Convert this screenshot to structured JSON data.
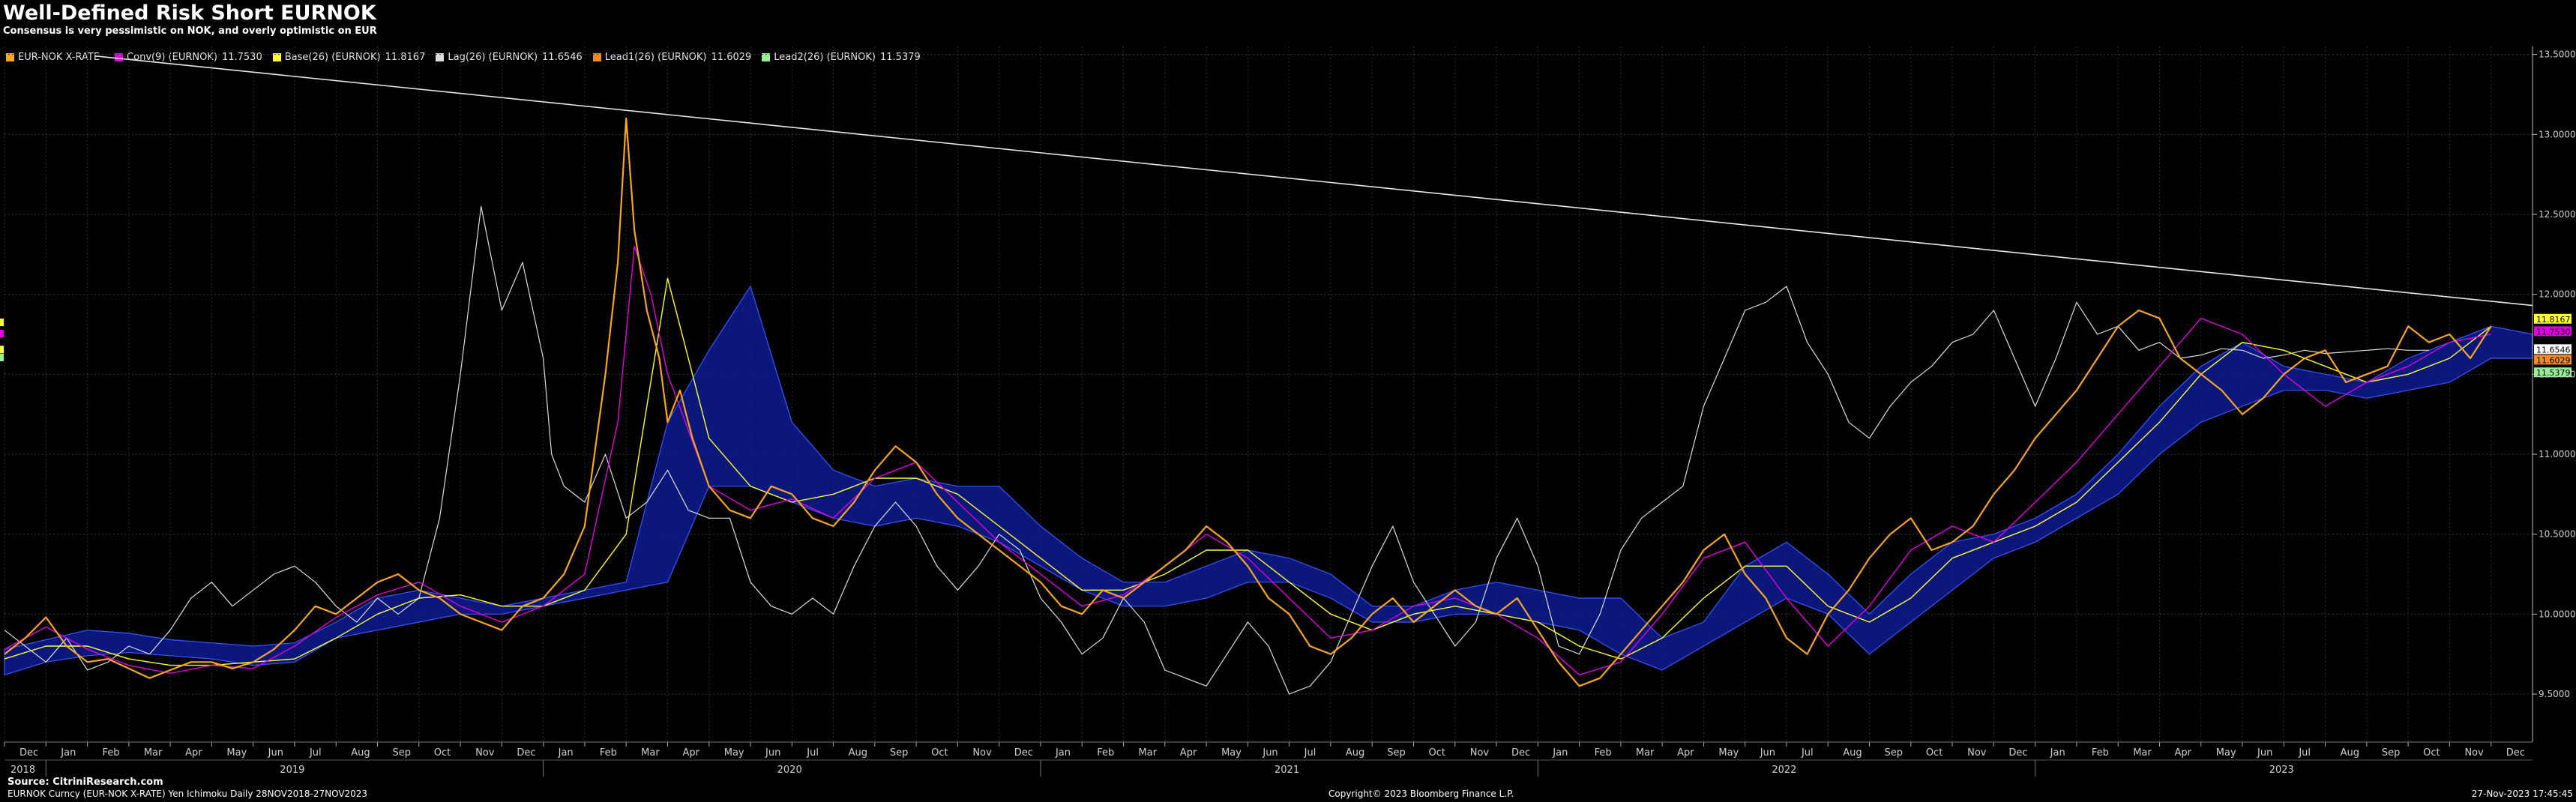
{
  "header": {
    "title": "Well-Defined Risk Short EURNOK",
    "subtitle": "Consensus is very pessimistic on NOK, and overly optimistic on EUR"
  },
  "legend": [
    {
      "label": "EUR-NOK X-RATE",
      "value": "",
      "color": "#f5a623"
    },
    {
      "label": "Conv(9) (EURNOK)",
      "value": "11.7530",
      "color": "#e000e0"
    },
    {
      "label": "Base(26) (EURNOK)",
      "value": "11.8167",
      "color": "#ffff33"
    },
    {
      "label": "Lag(26) (EURNOK)",
      "value": "11.6546",
      "color": "#dddddd"
    },
    {
      "label": "Lead1(26) (EURNOK)",
      "value": "11.6029",
      "color": "#f28c28"
    },
    {
      "label": "Lead2(26) (EURNOK)",
      "value": "11.5379",
      "color": "#99ee99"
    }
  ],
  "footer": {
    "source": "Source: CitriniResearch.com",
    "ticker": "EURNOK Curncy (EUR-NOK X-RATE) Yen Ichimoku  Daily 28NOV2018-27NOV2023",
    "copyright": "Copyright© 2023 Bloomberg Finance L.P.",
    "timestamp": "27-Nov-2023 17:45:45"
  },
  "chart_data": {
    "type": "line",
    "ylim": [
      9.2,
      13.55
    ],
    "yticks": [
      "9.5000",
      "10.0000",
      "10.5000",
      "11.0000",
      "11.5000",
      "12.0000",
      "12.5000",
      "13.0000",
      "13.5000"
    ],
    "ytick_values": [
      9.5,
      10.0,
      10.5,
      11.0,
      11.5,
      12.0,
      12.5,
      13.0,
      13.5
    ],
    "x_range_months": [
      0,
      61
    ],
    "month_ticks": [
      "Dec",
      "Jan",
      "Feb",
      "Mar",
      "Apr",
      "May",
      "Jun",
      "Jul",
      "Aug",
      "Sep",
      "Oct",
      "Nov",
      "Dec",
      "Jan",
      "Feb",
      "Mar",
      "Apr",
      "May",
      "Jun",
      "Jul",
      "Aug",
      "Sep",
      "Oct",
      "Nov",
      "Dec",
      "Jan",
      "Feb",
      "Mar",
      "Apr",
      "May",
      "Jun",
      "Jul",
      "Aug",
      "Sep",
      "Oct",
      "Nov",
      "Dec",
      "Jan",
      "Feb",
      "Mar",
      "Apr",
      "May",
      "Jun",
      "Jul",
      "Aug",
      "Sep",
      "Oct",
      "Nov",
      "Dec",
      "Jan",
      "Feb",
      "Mar",
      "Apr",
      "May",
      "Jun",
      "Jul",
      "Aug",
      "Sep",
      "Oct",
      "Nov",
      "Dec"
    ],
    "year_labels": [
      {
        "label": "2018",
        "month": 0
      },
      {
        "label": "2019",
        "month": 6.5
      },
      {
        "label": "2020",
        "month": 18.5
      },
      {
        "label": "2021",
        "month": 30.5
      },
      {
        "label": "2022",
        "month": 42.5
      },
      {
        "label": "2023",
        "month": 54.5
      }
    ],
    "trendline": {
      "x": [
        2.2,
        61.0
      ],
      "y": [
        13.49,
        11.93
      ]
    },
    "right_markers": [
      {
        "value": "11.8167",
        "y": 11.8167,
        "color": "#ffff33"
      },
      {
        "value": "11.7530",
        "y": 11.753,
        "color": "#e000e0"
      },
      {
        "value": "11.6546",
        "y": 11.6546,
        "color": "#ffffff"
      },
      {
        "value": "11.6029",
        "y": 11.6029,
        "color": "#f28c28"
      },
      {
        "value": "11.5379",
        "y": 11.5379,
        "color": "#99ee99"
      }
    ],
    "series": [
      {
        "name": "EUR-NOK X-RATE",
        "color": "#f5a623",
        "x": [
          0,
          0.5,
          1,
          1.5,
          2,
          2.5,
          3,
          3.5,
          4,
          4.5,
          5,
          5.5,
          6,
          6.5,
          7,
          7.5,
          8,
          8.5,
          9,
          9.5,
          10,
          10.5,
          11,
          11.5,
          12,
          12.5,
          13,
          13.5,
          14,
          14.5,
          14.8,
          15,
          15.2,
          15.5,
          15.8,
          16,
          16.3,
          16.6,
          17,
          17.5,
          18,
          18.5,
          19,
          19.5,
          20,
          20.5,
          21,
          21.5,
          22,
          22.5,
          23,
          23.5,
          24,
          24.5,
          25,
          25.5,
          26,
          26.5,
          27,
          27.5,
          28,
          28.5,
          29,
          29.5,
          30,
          30.5,
          31,
          31.5,
          32,
          32.5,
          33,
          33.5,
          34,
          34.5,
          35,
          35.5,
          36,
          36.5,
          37,
          37.5,
          38,
          38.5,
          39,
          39.5,
          40,
          40.5,
          41,
          41.5,
          42,
          42.5,
          43,
          43.5,
          44,
          44.5,
          45,
          45.5,
          46,
          46.5,
          47,
          47.5,
          48,
          48.5,
          49,
          49.5,
          50,
          50.5,
          51,
          51.5,
          52,
          52.5,
          53,
          53.5,
          54,
          54.5,
          55,
          55.5,
          56,
          56.5,
          57,
          57.5,
          58,
          58.5,
          59,
          59.5,
          60
        ],
        "y": [
          9.75,
          9.85,
          9.98,
          9.8,
          9.7,
          9.72,
          9.66,
          9.6,
          9.65,
          9.7,
          9.7,
          9.66,
          9.7,
          9.78,
          9.9,
          10.05,
          10.0,
          10.1,
          10.2,
          10.25,
          10.15,
          10.1,
          10.0,
          9.95,
          9.9,
          10.05,
          10.1,
          10.25,
          10.55,
          11.5,
          12.2,
          13.1,
          12.4,
          11.9,
          11.6,
          11.2,
          11.4,
          11.1,
          10.8,
          10.65,
          10.6,
          10.8,
          10.75,
          10.6,
          10.55,
          10.7,
          10.9,
          11.05,
          10.95,
          10.75,
          10.6,
          10.5,
          10.4,
          10.3,
          10.2,
          10.05,
          10.0,
          10.15,
          10.1,
          10.2,
          10.3,
          10.4,
          10.55,
          10.45,
          10.3,
          10.1,
          10.0,
          9.8,
          9.75,
          9.85,
          10.0,
          10.1,
          9.95,
          10.05,
          10.15,
          10.05,
          10.0,
          10.1,
          9.9,
          9.7,
          9.55,
          9.6,
          9.75,
          9.9,
          10.05,
          10.2,
          10.4,
          10.5,
          10.25,
          10.1,
          9.85,
          9.75,
          10.0,
          10.15,
          10.35,
          10.5,
          10.6,
          10.4,
          10.45,
          10.55,
          10.75,
          10.9,
          11.1,
          11.25,
          11.4,
          11.6,
          11.8,
          11.9,
          11.85,
          11.6,
          11.5,
          11.4,
          11.25,
          11.35,
          11.5,
          11.6,
          11.65,
          11.45,
          11.5,
          11.55,
          11.8,
          11.7,
          11.75,
          11.6,
          11.8
        ]
      },
      {
        "name": "Conv(9) (EURNOK)",
        "color": "#e000e0",
        "x": [
          0,
          1,
          2,
          3,
          4,
          5,
          6,
          7,
          8,
          9,
          10,
          11,
          12,
          13,
          14,
          14.8,
          15.2,
          15.6,
          16,
          17,
          18,
          19,
          20,
          21,
          22,
          23,
          24,
          25,
          26,
          27,
          28,
          29,
          30,
          31,
          32,
          33,
          34,
          35,
          36,
          37,
          38,
          39,
          40,
          41,
          42,
          43,
          44,
          45,
          46,
          47,
          48,
          49,
          50,
          51,
          52,
          53,
          54,
          55,
          56,
          57,
          58,
          59,
          60
        ],
        "y": [
          9.78,
          9.92,
          9.78,
          9.68,
          9.63,
          9.68,
          9.66,
          9.8,
          9.98,
          10.12,
          10.2,
          10.05,
          9.95,
          10.05,
          10.25,
          11.2,
          12.3,
          12.0,
          11.5,
          10.8,
          10.65,
          10.72,
          10.6,
          10.85,
          10.95,
          10.7,
          10.45,
          10.25,
          10.05,
          10.12,
          10.3,
          10.5,
          10.35,
          10.1,
          9.85,
          9.9,
          10.05,
          10.1,
          10.0,
          9.85,
          9.62,
          9.7,
          10.0,
          10.35,
          10.45,
          10.1,
          9.8,
          10.05,
          10.4,
          10.55,
          10.45,
          10.7,
          10.95,
          11.25,
          11.55,
          11.85,
          11.75,
          11.5,
          11.3,
          11.45,
          11.55,
          11.7,
          11.75
        ]
      },
      {
        "name": "Base(26) (EURNOK)",
        "color": "#ffff33",
        "x": [
          0,
          1,
          2,
          3,
          4,
          5,
          6,
          7,
          8,
          9,
          10,
          11,
          12,
          13,
          14,
          15,
          15.5,
          16,
          17,
          18,
          19,
          20,
          21,
          22,
          23,
          24,
          25,
          26,
          27,
          28,
          29,
          30,
          31,
          32,
          33,
          34,
          35,
          36,
          37,
          38,
          39,
          40,
          41,
          42,
          43,
          44,
          45,
          46,
          47,
          48,
          49,
          50,
          51,
          52,
          53,
          54,
          55,
          56,
          57,
          58,
          59,
          60
        ],
        "y": [
          9.72,
          9.8,
          9.8,
          9.72,
          9.68,
          9.68,
          9.7,
          9.72,
          9.85,
          10.0,
          10.1,
          10.12,
          10.05,
          10.05,
          10.15,
          10.5,
          11.3,
          12.1,
          11.1,
          10.8,
          10.7,
          10.75,
          10.85,
          10.85,
          10.75,
          10.55,
          10.35,
          10.15,
          10.15,
          10.25,
          10.4,
          10.4,
          10.2,
          10.0,
          9.9,
          10.0,
          10.05,
          10.0,
          9.95,
          9.8,
          9.72,
          9.85,
          10.1,
          10.3,
          10.3,
          10.05,
          9.95,
          10.1,
          10.35,
          10.45,
          10.55,
          10.7,
          10.95,
          11.2,
          11.5,
          11.7,
          11.65,
          11.55,
          11.45,
          11.5,
          11.6,
          11.8
        ]
      },
      {
        "name": "Lag(26) (EURNOK)",
        "color": "#dddddd",
        "x": [
          0,
          0.5,
          1,
          1.5,
          2,
          2.5,
          3,
          3.5,
          4,
          4.5,
          5,
          5.5,
          6,
          6.5,
          7,
          7.5,
          8,
          8.5,
          9,
          9.5,
          10,
          10.5,
          11,
          11.5,
          12,
          12.5,
          13,
          13.2,
          13.5,
          14,
          14.5,
          15,
          15.5,
          16,
          16.5,
          17,
          17.5,
          18,
          18.5,
          19,
          19.5,
          20,
          20.5,
          21,
          21.5,
          22,
          22.5,
          23,
          23.5,
          24,
          24.5,
          25,
          25.5,
          26,
          26.5,
          27,
          27.5,
          28,
          28.5,
          29,
          29.5,
          30,
          30.5,
          31,
          31.5,
          32,
          32.5,
          33,
          33.5,
          34,
          34.5,
          35,
          35.5,
          36,
          36.5,
          37,
          37.5,
          38,
          38.5,
          39,
          39.5,
          40,
          40.5,
          41,
          41.5,
          42,
          42.5,
          43,
          43.5,
          44,
          44.5,
          45,
          45.5,
          46,
          46.5,
          47,
          47.5,
          48,
          48.5,
          49,
          49.5,
          50,
          50.5,
          51,
          51.5,
          52,
          52.5,
          53,
          53.5,
          54,
          54.5,
          55,
          55.5,
          56,
          56.5,
          57,
          57.5,
          58,
          58.5
        ],
        "y": [
          9.9,
          9.8,
          9.7,
          9.85,
          9.65,
          9.7,
          9.8,
          9.75,
          9.9,
          10.1,
          10.2,
          10.05,
          10.15,
          10.25,
          10.3,
          10.2,
          10.05,
          9.95,
          10.1,
          10.0,
          10.1,
          10.6,
          11.5,
          12.55,
          11.9,
          12.2,
          11.6,
          11.0,
          10.8,
          10.7,
          11.0,
          10.6,
          10.7,
          10.9,
          10.65,
          10.6,
          10.6,
          10.2,
          10.05,
          10.0,
          10.1,
          10.0,
          10.3,
          10.55,
          10.7,
          10.55,
          10.3,
          10.15,
          10.3,
          10.5,
          10.4,
          10.1,
          9.95,
          9.75,
          9.85,
          10.1,
          9.95,
          9.65,
          9.6,
          9.55,
          9.75,
          9.95,
          9.8,
          9.5,
          9.55,
          9.7,
          10.0,
          10.3,
          10.55,
          10.2,
          10.0,
          9.8,
          9.95,
          10.35,
          10.6,
          10.3,
          9.8,
          9.75,
          10.0,
          10.4,
          10.6,
          10.7,
          10.8,
          11.3,
          11.6,
          11.9,
          11.95,
          12.05,
          11.7,
          11.5,
          11.2,
          11.1,
          11.3,
          11.45,
          11.55,
          11.7,
          11.75,
          11.9,
          11.6,
          11.3,
          11.6,
          11.95,
          11.75,
          11.8,
          11.65,
          11.7,
          11.6,
          11.62,
          11.66,
          11.65,
          11.6,
          11.62,
          11.65,
          11.63,
          11.64,
          11.65,
          11.66,
          11.65,
          11.65
        ]
      }
    ],
    "cloud": {
      "x": [
        0,
        1,
        2,
        3,
        4,
        5,
        6,
        7,
        8,
        9,
        10,
        11,
        12,
        13,
        14,
        15,
        16,
        17,
        18,
        19,
        20,
        21,
        22,
        23,
        24,
        25,
        26,
        27,
        28,
        29,
        30,
        31,
        32,
        33,
        34,
        35,
        36,
        37,
        38,
        39,
        40,
        41,
        42,
        43,
        44,
        45,
        46,
        47,
        48,
        49,
        50,
        51,
        52,
        53,
        54,
        55,
        56,
        57,
        58,
        59,
        60,
        61
      ],
      "upper": [
        9.78,
        9.84,
        9.9,
        9.88,
        9.84,
        9.82,
        9.8,
        9.82,
        9.95,
        10.1,
        10.15,
        10.1,
        10.05,
        10.1,
        10.15,
        10.2,
        11.2,
        11.65,
        12.05,
        11.2,
        10.9,
        10.8,
        10.85,
        10.8,
        10.8,
        10.55,
        10.35,
        10.2,
        10.2,
        10.3,
        10.4,
        10.35,
        10.25,
        10.05,
        10.05,
        10.15,
        10.2,
        10.15,
        10.1,
        10.1,
        9.85,
        9.95,
        10.3,
        10.45,
        10.25,
        10.0,
        10.25,
        10.45,
        10.5,
        10.6,
        10.75,
        11.0,
        11.3,
        11.55,
        11.7,
        11.55,
        11.5,
        11.45,
        11.6,
        11.7,
        11.8,
        11.75
      ],
      "lower": [
        9.62,
        9.7,
        9.74,
        9.76,
        9.74,
        9.72,
        9.68,
        9.7,
        9.85,
        9.9,
        9.95,
        10.0,
        10.0,
        10.05,
        10.1,
        10.15,
        10.2,
        10.8,
        10.8,
        10.7,
        10.6,
        10.55,
        10.6,
        10.55,
        10.45,
        10.3,
        10.15,
        10.05,
        10.05,
        10.1,
        10.2,
        10.2,
        10.1,
        9.95,
        9.95,
        10.0,
        10.0,
        9.95,
        9.9,
        9.75,
        9.65,
        9.8,
        9.95,
        10.1,
        10.0,
        9.75,
        9.95,
        10.15,
        10.35,
        10.45,
        10.6,
        10.75,
        11.0,
        11.2,
        11.3,
        11.4,
        11.4,
        11.35,
        11.4,
        11.45,
        11.6,
        11.6
      ]
    }
  }
}
